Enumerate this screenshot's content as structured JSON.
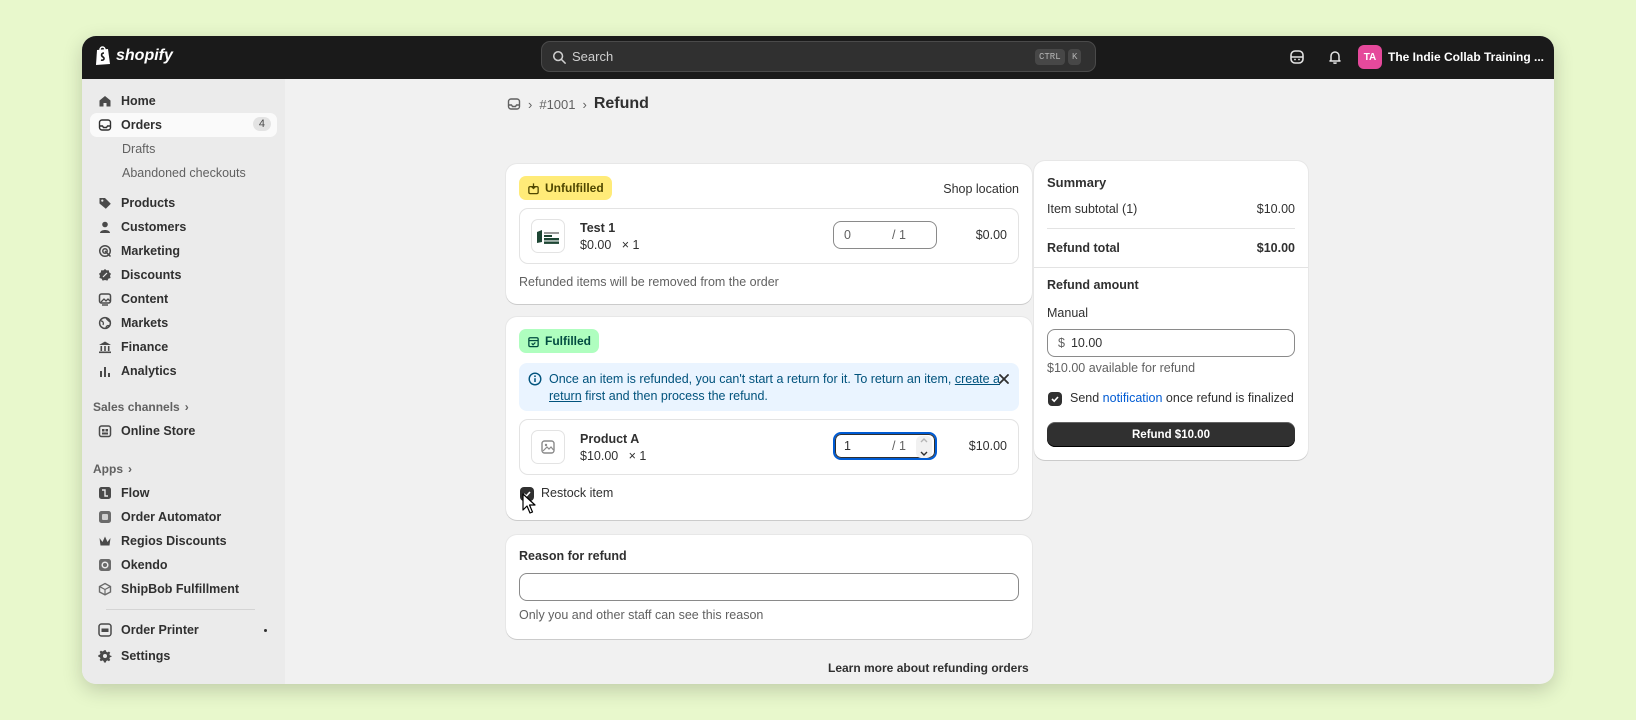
{
  "topbar": {
    "brand": "shopify",
    "search_placeholder": "Search",
    "shortcut_key1": "CTRL",
    "shortcut_key2": "K",
    "avatar_initials": "TA",
    "store_name": "The Indie Collab Training ..."
  },
  "sidebar": {
    "home": "Home",
    "orders": "Orders",
    "orders_count": "4",
    "drafts": "Drafts",
    "abandoned": "Abandoned checkouts",
    "products": "Products",
    "customers": "Customers",
    "marketing": "Marketing",
    "discounts": "Discounts",
    "content": "Content",
    "markets": "Markets",
    "finance": "Finance",
    "analytics": "Analytics",
    "sales_channels": "Sales channels",
    "online_store": "Online Store",
    "apps": "Apps",
    "flow": "Flow",
    "order_automator": "Order Automator",
    "regios": "Regios Discounts",
    "okendo": "Okendo",
    "shipbob": "ShipBob Fulfillment",
    "order_printer": "Order Printer",
    "settings": "Settings"
  },
  "breadcrumb": {
    "order": "#1001",
    "title": "Refund"
  },
  "unfulfilled": {
    "badge": "Unfulfilled",
    "location": "Shop location",
    "item_name": "Test 1",
    "item_price": "$0.00",
    "item_mult": "× 1",
    "qty_value": "0",
    "qty_of": "/ 1",
    "item_total": "$0.00",
    "help": "Refunded items will be removed from the order"
  },
  "fulfilled": {
    "badge": "Fulfilled",
    "banner_text_1": "Once an item is refunded, you can't start a return for it. To return an item, ",
    "banner_link": "create a return",
    "banner_text_2": " first and then process the refund.",
    "item_name": "Product A",
    "item_price": "$10.00",
    "item_mult": "× 1",
    "qty_value": "1",
    "qty_of": "/ 1",
    "item_total": "$10.00",
    "restock_label": "Restock item",
    "restock_checked": true
  },
  "reason": {
    "label": "Reason for refund",
    "value": "",
    "help": "Only you and other staff can see this reason"
  },
  "learn_more": "Learn more about refunding orders",
  "summary": {
    "title": "Summary",
    "subtotal_label": "Item subtotal (1)",
    "subtotal_value": "$10.00",
    "total_label": "Refund total",
    "total_value": "$10.00",
    "amount_title": "Refund amount",
    "manual_label": "Manual",
    "currency": "$",
    "amount_value": "10.00",
    "available": "$10.00 available for refund",
    "notify_pre": "Send ",
    "notify_link": "notification",
    "notify_post": " once refund is finalized",
    "notify_checked": true,
    "button": "Refund $10.00"
  }
}
